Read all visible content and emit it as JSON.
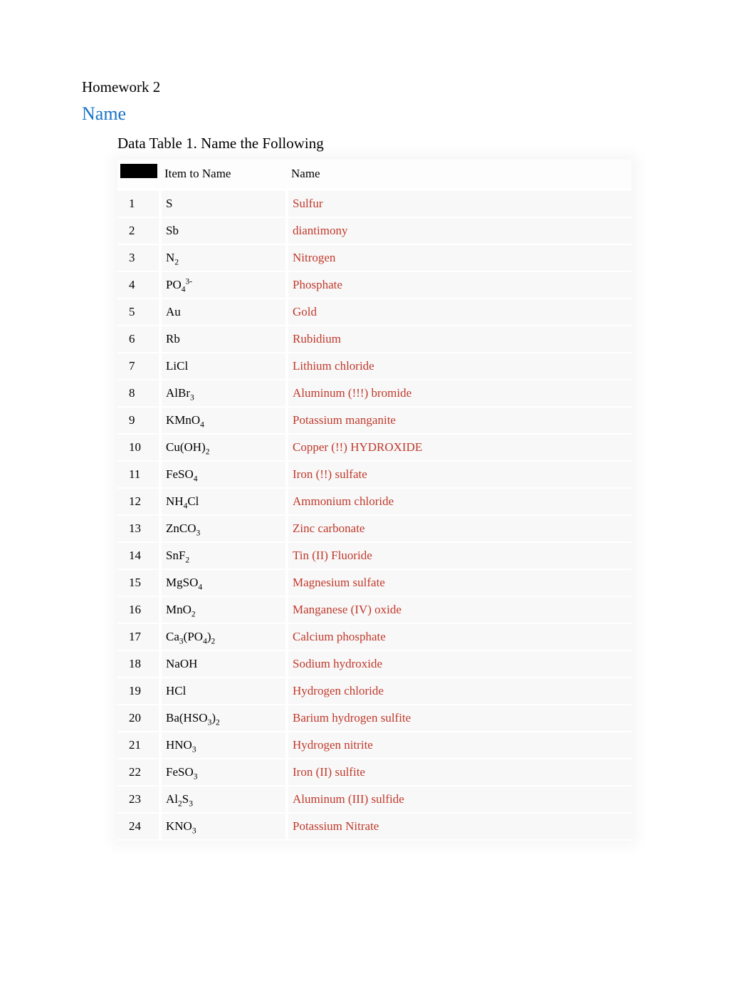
{
  "header": {
    "homework_title": "Homework 2",
    "name_label": "Name",
    "table_caption": "Data Table 1.  Name the Following"
  },
  "columns": {
    "item": "Item to Name",
    "name": "Name"
  },
  "rows": [
    {
      "num": "1",
      "item_html": "S",
      "name": "Sulfur"
    },
    {
      "num": "2",
      "item_html": "Sb",
      "name": "diantimony"
    },
    {
      "num": "3",
      "item_html": "N<span class='sub'>2</span>",
      "name": "Nitrogen"
    },
    {
      "num": "4",
      "item_html": "PO<span class='sub'>4</span><span class='sup'>3-</span>",
      "name": "Phosphate"
    },
    {
      "num": "5",
      "item_html": "Au",
      "name": "Gold"
    },
    {
      "num": "6",
      "item_html": "Rb",
      "name": "Rubidium"
    },
    {
      "num": "7",
      "item_html": "LiCl",
      "name": "Lithium chloride"
    },
    {
      "num": "8",
      "item_html": "AlBr<span class='sub'>3</span>",
      "name": "Aluminum (!!!) bromide"
    },
    {
      "num": "9",
      "item_html": "KMnO<span class='sub'>4</span>",
      "name": "Potassium manganite"
    },
    {
      "num": "10",
      "item_html": "Cu(OH)<span class='sub'>2</span>",
      "name": "Copper (!!) HYDROXIDE"
    },
    {
      "num": "11",
      "item_html": "FeSO<span class='sub'>4</span>",
      "name": "Iron (!!) sulfate"
    },
    {
      "num": "12",
      "item_html": "NH<span class='sub'>4</span>Cl",
      "name": "Ammonium chloride"
    },
    {
      "num": "13",
      "item_html": "ZnCO<span class='sub'>3</span>",
      "name": "Zinc carbonate"
    },
    {
      "num": "14",
      "item_html": "SnF<span class='sub'>2</span>",
      "name": "Tin (II) Fluoride"
    },
    {
      "num": "15",
      "item_html": "MgSO<span class='sub'>4</span>",
      "name": "Magnesium sulfate"
    },
    {
      "num": "16",
      "item_html": "MnO<span class='sub'>2</span>",
      "name": "Manganese (IV) oxide"
    },
    {
      "num": "17",
      "item_html": "Ca<span class='sub'>3</span>(PO<span class='sub'>4</span>)<span class='sub'>2</span>",
      "name": "Calcium phosphate"
    },
    {
      "num": "18",
      "item_html": "NaOH",
      "name": "Sodium hydroxide"
    },
    {
      "num": "19",
      "item_html": "HCl",
      "name": "Hydrogen chloride"
    },
    {
      "num": "20",
      "item_html": "Ba(HSO<span class='sub'>3</span>)<span class='sub'>2</span>",
      "name": "Barium hydrogen sulfite"
    },
    {
      "num": "21",
      "item_html": "HNO<span class='sub'>3</span>",
      "name": "Hydrogen nitrite"
    },
    {
      "num": "22",
      "item_html": "FeSO<span class='sub'>3</span>",
      "name": "Iron (II) sulfite"
    },
    {
      "num": "23",
      "item_html": "Al<span class='sub'>2</span>S<span class='sub'>3</span>",
      "name": "Aluminum (III) sulfide"
    },
    {
      "num": "24",
      "item_html": "KNO<span class='sub'>3</span>",
      "name": "Potassium Nitrate"
    }
  ]
}
